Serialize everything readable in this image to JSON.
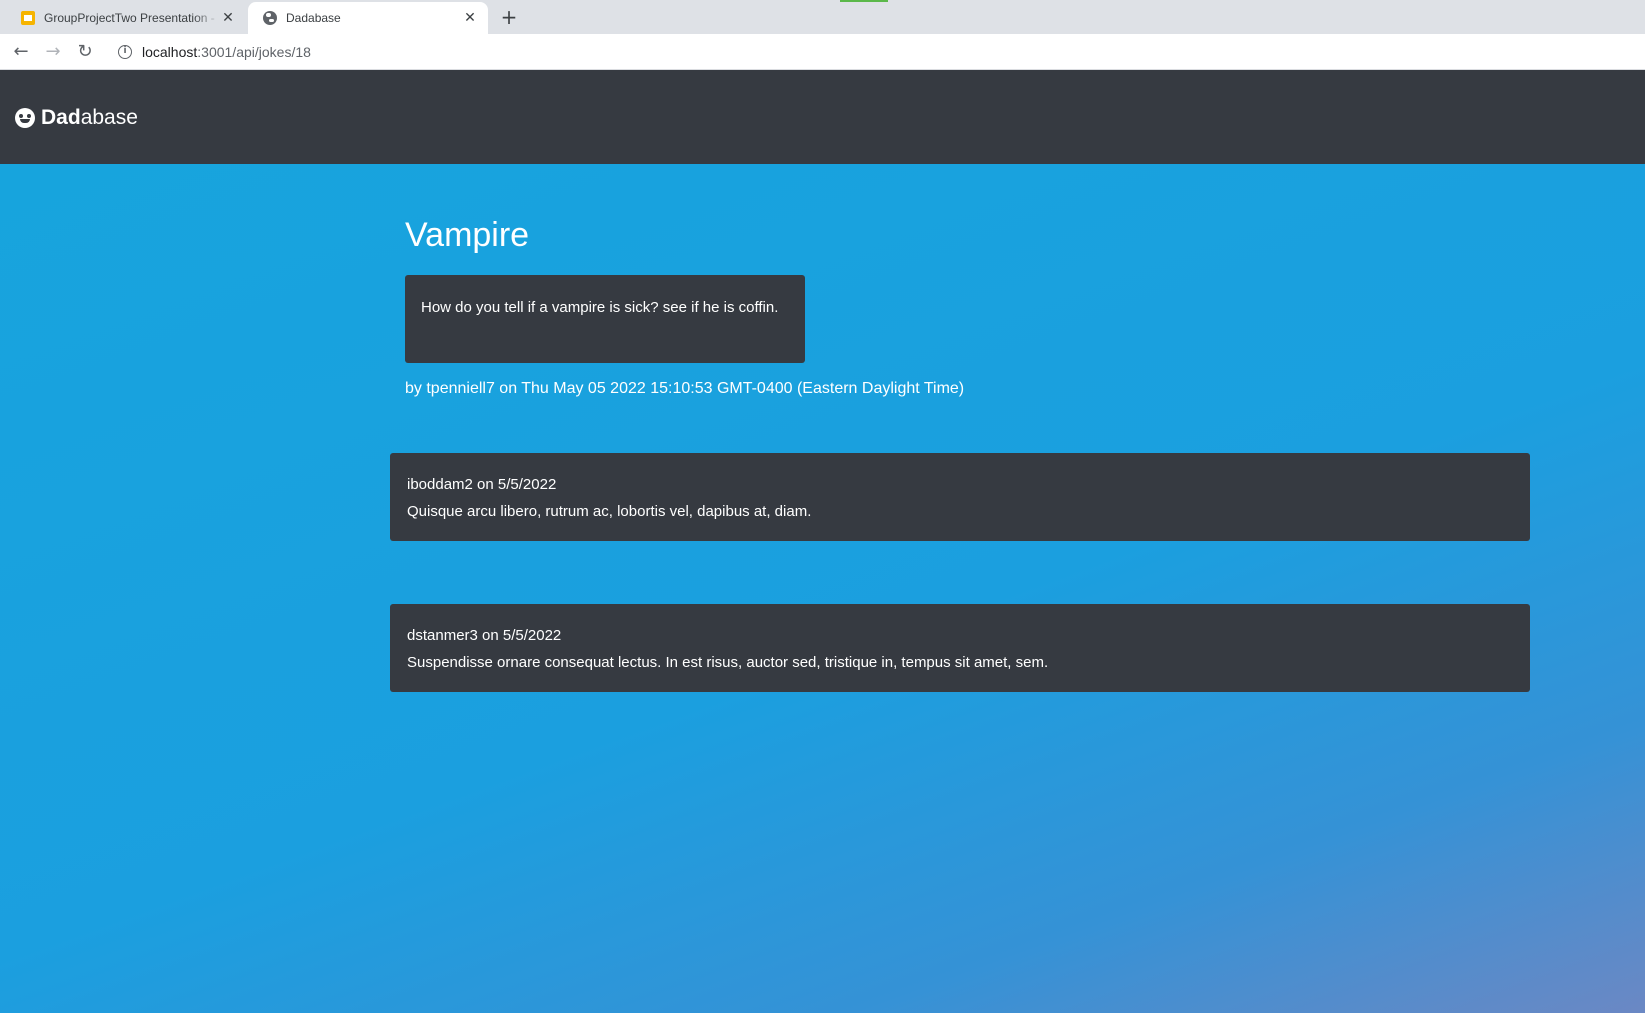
{
  "browser": {
    "tabs": [
      {
        "title": "GroupProjectTwo Presentation - ",
        "close": "✕",
        "icon": "slides-icon"
      },
      {
        "title": "Dadabase",
        "close": "✕",
        "icon": "globe-icon"
      }
    ],
    "new_tab": "+",
    "url_host": "localhost",
    "url_path": ":3001/api/jokes/18",
    "nav": {
      "back": "←",
      "forward": "→",
      "reload": "↻",
      "info": "i"
    }
  },
  "app": {
    "brand_bold": "Dad",
    "brand_rest": "abase",
    "colors": {
      "navbar": "#363a41",
      "background": "#1aa0de",
      "card": "#363a41"
    }
  },
  "joke": {
    "title": "Vampire",
    "text": "How do you tell if a vampire is sick? see if he is coffin.",
    "byline": "by tpenniell7 on Thu May 05 2022 15:10:53 GMT-0400 (Eastern Daylight Time)"
  },
  "comments": [
    {
      "meta": "iboddam2 on 5/5/2022",
      "text": "Quisque arcu libero, rutrum ac, lobortis vel, dapibus at, diam."
    },
    {
      "meta": "dstanmer3 on 5/5/2022",
      "text": "Suspendisse ornare consequat lectus. In est risus, auctor sed, tristique in, tempus sit amet, sem."
    }
  ]
}
